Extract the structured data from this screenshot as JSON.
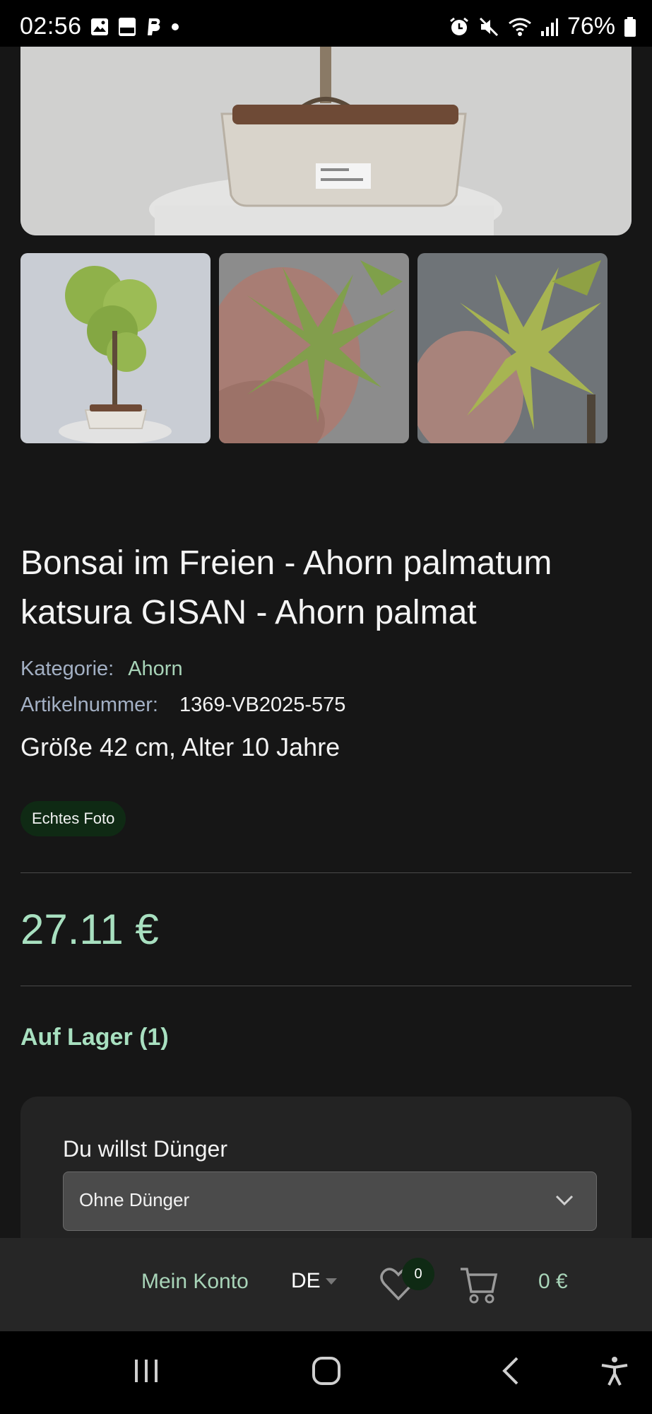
{
  "status_bar": {
    "time": "02:56",
    "battery": "76%"
  },
  "product": {
    "title": "Bonsai im Freien - Ahorn palmatum katsura GISAN - Ahorn palmat",
    "category_label": "Kategorie:",
    "category_value": "Ahorn",
    "sku_label": "Artikelnummer:",
    "sku_value": "1369-VB2025-575",
    "size_age": "Größe 42 cm, Alter 10 Jahre",
    "badge": "Echtes Foto",
    "price": "27.11 €",
    "stock": "Auf Lager (1)"
  },
  "options": {
    "label": "Du willst Dünger",
    "selected": "Ohne Dünger"
  },
  "bottom_bar": {
    "account": "Mein Konto",
    "language": "DE",
    "wishlist_count": "0",
    "cart_total": "0 €"
  },
  "colors": {
    "accent_green": "#a8e0c0",
    "badge_bg": "#0f2a14",
    "background": "#161616"
  }
}
